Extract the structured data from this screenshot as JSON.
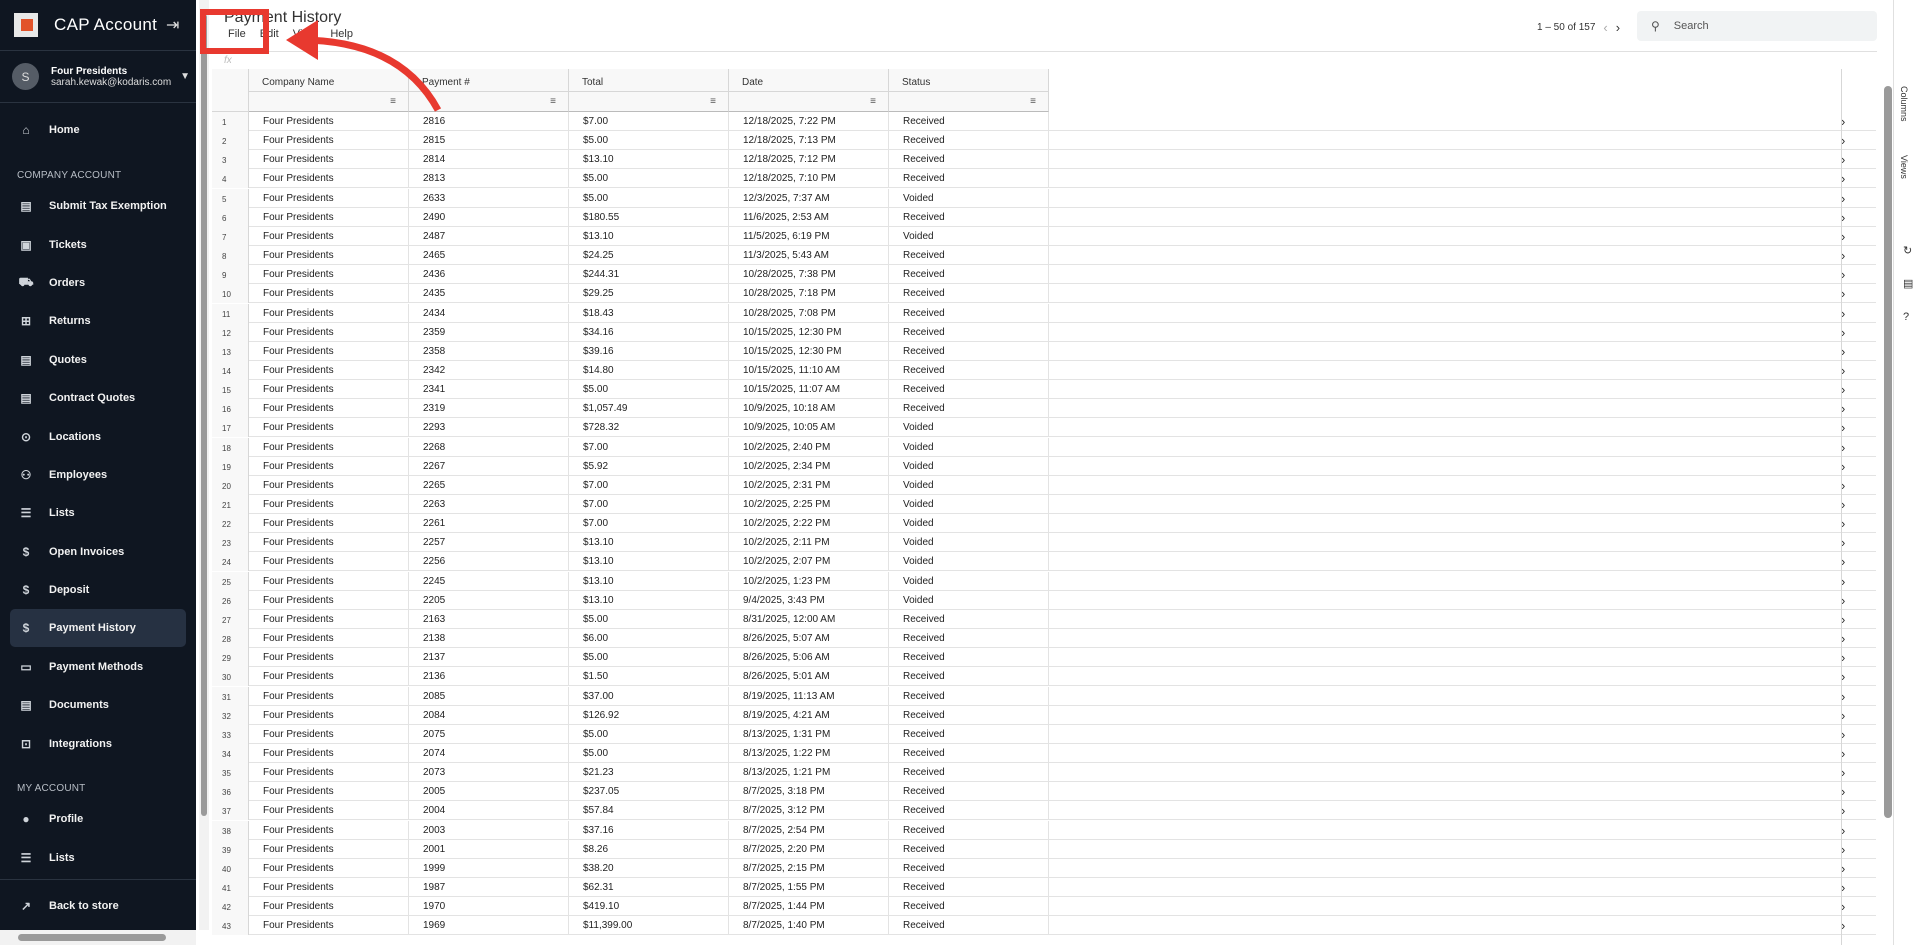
{
  "sidebar": {
    "title": "CAP Account",
    "user": {
      "initial": "S",
      "name": "Four Presidents",
      "email": "sarah.kewak@kodaris.com"
    },
    "sections": {
      "company": "COMPANY ACCOUNT",
      "my": "MY ACCOUNT"
    },
    "items": [
      {
        "label": "Home",
        "icon": "home-icon",
        "glyph": "⌂"
      },
      {
        "label": "Submit Tax Exemption",
        "icon": "document-icon",
        "glyph": "▤"
      },
      {
        "label": "Tickets",
        "icon": "ticket-icon",
        "glyph": "▣"
      },
      {
        "label": "Orders",
        "icon": "truck-icon",
        "glyph": "⛟"
      },
      {
        "label": "Returns",
        "icon": "return-icon",
        "glyph": "⊞"
      },
      {
        "label": "Quotes",
        "icon": "clipboard-icon",
        "glyph": "▤"
      },
      {
        "label": "Contract Quotes",
        "icon": "clipboard-icon",
        "glyph": "▤"
      },
      {
        "label": "Locations",
        "icon": "pin-icon",
        "glyph": "⊙"
      },
      {
        "label": "Employees",
        "icon": "people-icon",
        "glyph": "⚇"
      },
      {
        "label": "Lists",
        "icon": "list-icon",
        "glyph": "☰"
      },
      {
        "label": "Open Invoices",
        "icon": "dollar-icon",
        "glyph": "$"
      },
      {
        "label": "Deposit",
        "icon": "dollar-icon",
        "glyph": "$"
      },
      {
        "label": "Payment History",
        "icon": "dollar-icon",
        "glyph": "$"
      },
      {
        "label": "Payment Methods",
        "icon": "card-icon",
        "glyph": "▭"
      },
      {
        "label": "Documents",
        "icon": "document-icon",
        "glyph": "▤"
      },
      {
        "label": "Integrations",
        "icon": "integration-icon",
        "glyph": "⊡"
      },
      {
        "label": "Profile",
        "icon": "person-icon",
        "glyph": "●"
      },
      {
        "label": "Lists",
        "icon": "list-icon",
        "glyph": "☰"
      },
      {
        "label": "Back to store",
        "icon": "external-link-icon",
        "glyph": "↗"
      }
    ],
    "active_index": 12
  },
  "header": {
    "title": "Payment History",
    "menu": [
      "File",
      "Edit",
      "View",
      "Help"
    ],
    "pager": "1 – 50 of 157",
    "search_placeholder": "Search",
    "fx": "fx"
  },
  "columns": [
    "Company Name",
    "Payment #",
    "Total",
    "Date",
    "Status"
  ],
  "side_tabs": [
    "Columns",
    "Views"
  ],
  "rows": [
    [
      "Four Presidents",
      "2816",
      "$7.00",
      "12/18/2025, 7:22 PM",
      "Received"
    ],
    [
      "Four Presidents",
      "2815",
      "$5.00",
      "12/18/2025, 7:13 PM",
      "Received"
    ],
    [
      "Four Presidents",
      "2814",
      "$13.10",
      "12/18/2025, 7:12 PM",
      "Received"
    ],
    [
      "Four Presidents",
      "2813",
      "$5.00",
      "12/18/2025, 7:10 PM",
      "Received"
    ],
    [
      "Four Presidents",
      "2633",
      "$5.00",
      "12/3/2025, 7:37 AM",
      "Voided"
    ],
    [
      "Four Presidents",
      "2490",
      "$180.55",
      "11/6/2025, 2:53 AM",
      "Received"
    ],
    [
      "Four Presidents",
      "2487",
      "$13.10",
      "11/5/2025, 6:19 PM",
      "Voided"
    ],
    [
      "Four Presidents",
      "2465",
      "$24.25",
      "11/3/2025, 5:43 AM",
      "Received"
    ],
    [
      "Four Presidents",
      "2436",
      "$244.31",
      "10/28/2025, 7:38 PM",
      "Received"
    ],
    [
      "Four Presidents",
      "2435",
      "$29.25",
      "10/28/2025, 7:18 PM",
      "Received"
    ],
    [
      "Four Presidents",
      "2434",
      "$18.43",
      "10/28/2025, 7:08 PM",
      "Received"
    ],
    [
      "Four Presidents",
      "2359",
      "$34.16",
      "10/15/2025, 12:30 PM",
      "Received"
    ],
    [
      "Four Presidents",
      "2358",
      "$39.16",
      "10/15/2025, 12:30 PM",
      "Received"
    ],
    [
      "Four Presidents",
      "2342",
      "$14.80",
      "10/15/2025, 11:10 AM",
      "Received"
    ],
    [
      "Four Presidents",
      "2341",
      "$5.00",
      "10/15/2025, 11:07 AM",
      "Received"
    ],
    [
      "Four Presidents",
      "2319",
      "$1,057.49",
      "10/9/2025, 10:18 AM",
      "Received"
    ],
    [
      "Four Presidents",
      "2293",
      "$728.32",
      "10/9/2025, 10:05 AM",
      "Voided"
    ],
    [
      "Four Presidents",
      "2268",
      "$7.00",
      "10/2/2025, 2:40 PM",
      "Voided"
    ],
    [
      "Four Presidents",
      "2267",
      "$5.92",
      "10/2/2025, 2:34 PM",
      "Voided"
    ],
    [
      "Four Presidents",
      "2265",
      "$7.00",
      "10/2/2025, 2:31 PM",
      "Voided"
    ],
    [
      "Four Presidents",
      "2263",
      "$7.00",
      "10/2/2025, 2:25 PM",
      "Voided"
    ],
    [
      "Four Presidents",
      "2261",
      "$7.00",
      "10/2/2025, 2:22 PM",
      "Voided"
    ],
    [
      "Four Presidents",
      "2257",
      "$13.10",
      "10/2/2025, 2:11 PM",
      "Voided"
    ],
    [
      "Four Presidents",
      "2256",
      "$13.10",
      "10/2/2025, 2:07 PM",
      "Voided"
    ],
    [
      "Four Presidents",
      "2245",
      "$13.10",
      "10/2/2025, 1:23 PM",
      "Voided"
    ],
    [
      "Four Presidents",
      "2205",
      "$13.10",
      "9/4/2025, 3:43 PM",
      "Voided"
    ],
    [
      "Four Presidents",
      "2163",
      "$5.00",
      "8/31/2025, 12:00 AM",
      "Received"
    ],
    [
      "Four Presidents",
      "2138",
      "$6.00",
      "8/26/2025, 5:07 AM",
      "Received"
    ],
    [
      "Four Presidents",
      "2137",
      "$5.00",
      "8/26/2025, 5:06 AM",
      "Received"
    ],
    [
      "Four Presidents",
      "2136",
      "$1.50",
      "8/26/2025, 5:01 AM",
      "Received"
    ],
    [
      "Four Presidents",
      "2085",
      "$37.00",
      "8/19/2025, 11:13 AM",
      "Received"
    ],
    [
      "Four Presidents",
      "2084",
      "$126.92",
      "8/19/2025, 4:21 AM",
      "Received"
    ],
    [
      "Four Presidents",
      "2075",
      "$5.00",
      "8/13/2025, 1:31 PM",
      "Received"
    ],
    [
      "Four Presidents",
      "2074",
      "$5.00",
      "8/13/2025, 1:22 PM",
      "Received"
    ],
    [
      "Four Presidents",
      "2073",
      "$21.23",
      "8/13/2025, 1:21 PM",
      "Received"
    ],
    [
      "Four Presidents",
      "2005",
      "$237.05",
      "8/7/2025, 3:18 PM",
      "Received"
    ],
    [
      "Four Presidents",
      "2004",
      "$57.84",
      "8/7/2025, 3:12 PM",
      "Received"
    ],
    [
      "Four Presidents",
      "2003",
      "$37.16",
      "8/7/2025, 2:54 PM",
      "Received"
    ],
    [
      "Four Presidents",
      "2001",
      "$8.26",
      "8/7/2025, 2:20 PM",
      "Received"
    ],
    [
      "Four Presidents",
      "1999",
      "$38.20",
      "8/7/2025, 2:15 PM",
      "Received"
    ],
    [
      "Four Presidents",
      "1987",
      "$62.31",
      "8/7/2025, 1:55 PM",
      "Received"
    ],
    [
      "Four Presidents",
      "1970",
      "$419.10",
      "8/7/2025, 1:44 PM",
      "Received"
    ],
    [
      "Four Presidents",
      "1969",
      "$11,399.00",
      "8/7/2025, 1:40 PM",
      "Received"
    ]
  ],
  "annotation": {
    "color": "#e8392f"
  }
}
